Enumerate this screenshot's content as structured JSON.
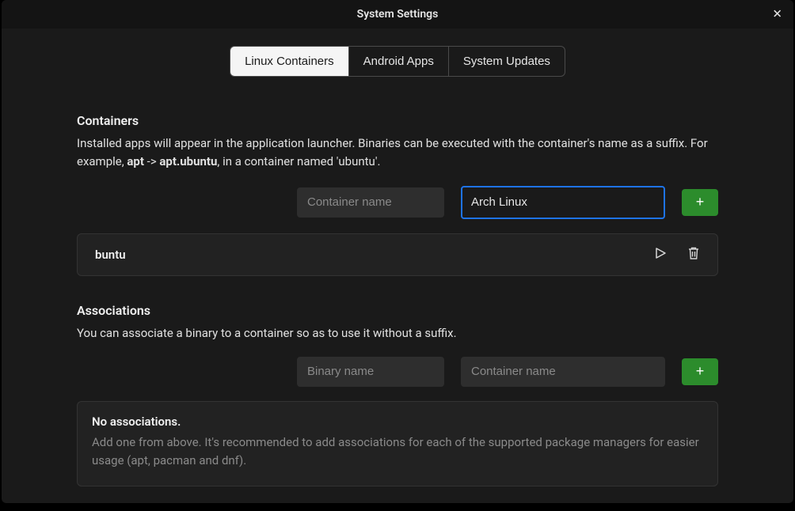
{
  "window": {
    "title": "System Settings"
  },
  "tabs": {
    "linux": "Linux Containers",
    "android": "Android Apps",
    "updates": "System Updates",
    "active": "linux"
  },
  "containers": {
    "title": "Containers",
    "desc_pre": "Installed apps will appear in the application launcher. Binaries can be executed with the container's name as a suffix. For example, ",
    "desc_b1": "apt",
    "desc_arrow": " -> ",
    "desc_b2": "apt.ubuntu",
    "desc_post": ", in a container named 'ubuntu'.",
    "name_placeholder": "Container name",
    "image_value": "Arch Linux",
    "add_label": "+",
    "rows": [
      {
        "name": "buntu"
      }
    ]
  },
  "associations": {
    "title": "Associations",
    "desc": "You can associate a binary to a container so as to use it without a suffix.",
    "binary_placeholder": "Binary name",
    "container_placeholder": "Container name",
    "add_label": "+",
    "empty_title": "No associations.",
    "empty_desc": "Add one from above. It's recommended to add associations for each of the supported package managers for easier usage (apt, pacman and dnf)."
  },
  "colors": {
    "accent_green": "#2c8c2c",
    "focus_blue": "#1e73e8"
  }
}
